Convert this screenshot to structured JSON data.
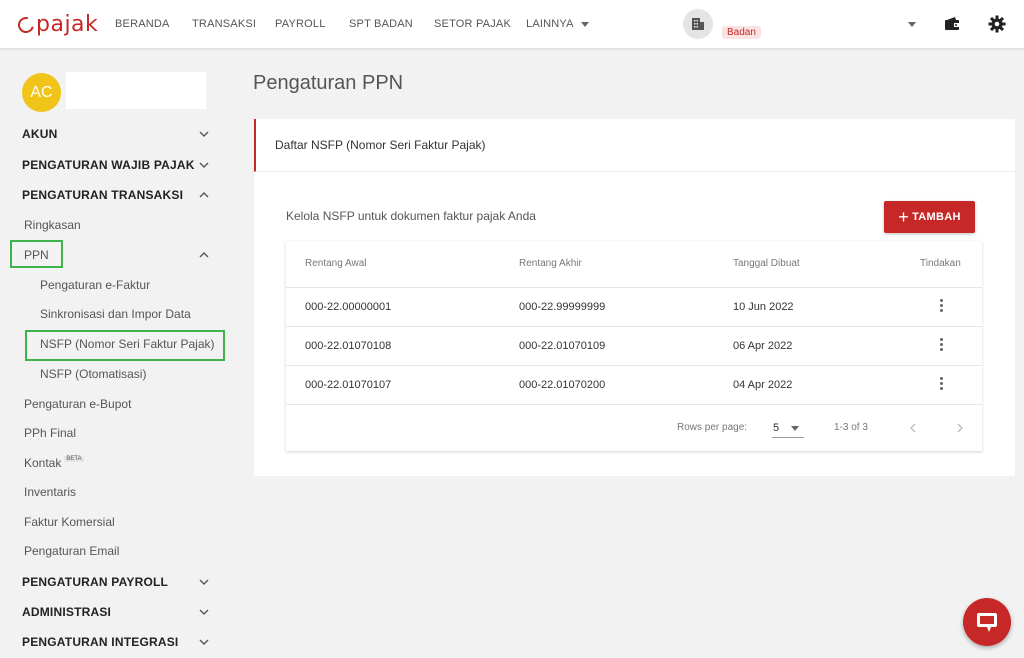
{
  "brand": {
    "logo_text": "pajak",
    "accent": "#c62828"
  },
  "nav": {
    "items": [
      "BERANDA",
      "TRANSAKSI",
      "PAYROLL",
      "SPT BADAN",
      "SETOR PAJAK",
      "LAINNYA"
    ],
    "company_badge": "Badan"
  },
  "icons": {
    "company": "building-icon",
    "wallet": "wallet-icon",
    "settings": "gear-icon",
    "chat": "chat-icon"
  },
  "sidebar": {
    "avatar_initials": "AC",
    "sections": [
      {
        "label": "AKUN",
        "expanded": false
      },
      {
        "label": "PENGATURAN WAJIB PAJAK",
        "expanded": false
      },
      {
        "label": "PENGATURAN TRANSAKSI",
        "expanded": true
      }
    ],
    "transaksi_items": {
      "ringkasan": "Ringkasan",
      "ppn": "PPN",
      "ppn_children": [
        "Pengaturan e-Faktur",
        "Sinkronisasi dan Impor Data",
        "NSFP (Nomor Seri Faktur Pajak)",
        "NSFP (Otomatisasi)"
      ],
      "others": [
        "Pengaturan e-Bupot",
        "PPh Final",
        "Kontak",
        "Inventaris",
        "Faktur Komersial",
        "Pengaturan Email"
      ],
      "beta_label": "BETA"
    },
    "bottom_sections": [
      "PENGATURAN PAYROLL",
      "ADMINISTRASI",
      "PENGATURAN INTEGRASI"
    ]
  },
  "main": {
    "title": "Pengaturan PPN",
    "card_title": "Daftar NSFP (Nomor Seri Faktur Pajak)",
    "description": "Kelola NSFP untuk dokumen faktur pajak Anda",
    "add_button": "TAMBAH",
    "table": {
      "headers": [
        "Rentang Awal",
        "Rentang Akhir",
        "Tanggal Dibuat",
        "Tindakan"
      ],
      "rows": [
        [
          "000-22.00000001",
          "000-22.99999999",
          "10 Jun 2022"
        ],
        [
          "000-22.01070108",
          "000-22.01070109",
          "06 Apr 2022"
        ],
        [
          "000-22.01070107",
          "000-22.01070200",
          "04 Apr 2022"
        ]
      ],
      "rows_per_page_label": "Rows per page:",
      "rows_per_page_value": "5",
      "range_text": "1-3 of 3"
    }
  }
}
